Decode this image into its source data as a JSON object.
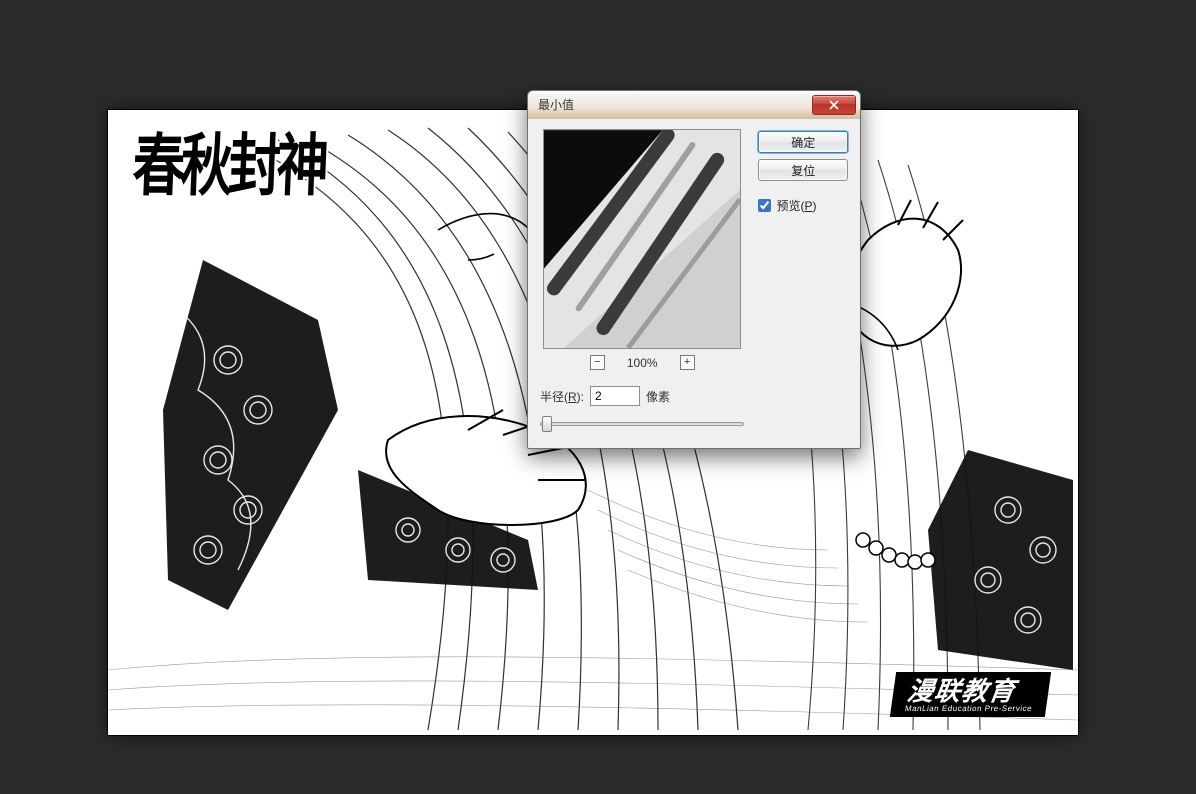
{
  "artwork": {
    "title_calligraphy": "春秋封神",
    "brand": "漫联教育",
    "brand_sub": "ManLian Education  Pre-Service"
  },
  "dialog": {
    "title": "最小值",
    "buttons": {
      "ok": "确定",
      "reset": "复位"
    },
    "preview_checkbox": {
      "label_prefix": "预览(",
      "hotkey": "P",
      "label_suffix": ")",
      "checked": true
    },
    "zoom": {
      "value": "100%"
    },
    "radius": {
      "label_prefix": "半径(",
      "hotkey": "R",
      "label_suffix": "):",
      "value": "2",
      "unit": "像素"
    }
  }
}
